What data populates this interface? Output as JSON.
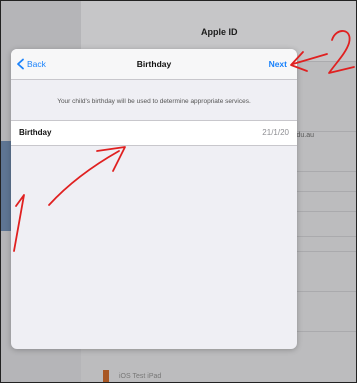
{
  "background": {
    "title": "Apple ID",
    "edu_fragment": "edu.au",
    "bottom_text": "iOS Test iPad"
  },
  "sheet": {
    "back_label": "Back",
    "title": "Birthday",
    "next_label": "Next",
    "info_text": "Your child's birthday will be used to determine appropriate services.",
    "row": {
      "label": "Birthday",
      "value": "21/1/20"
    }
  },
  "annotations": {
    "mark_1": "1",
    "mark_2": "2"
  },
  "colors": {
    "accent": "#1a82fb",
    "annotation": "#e02020"
  }
}
